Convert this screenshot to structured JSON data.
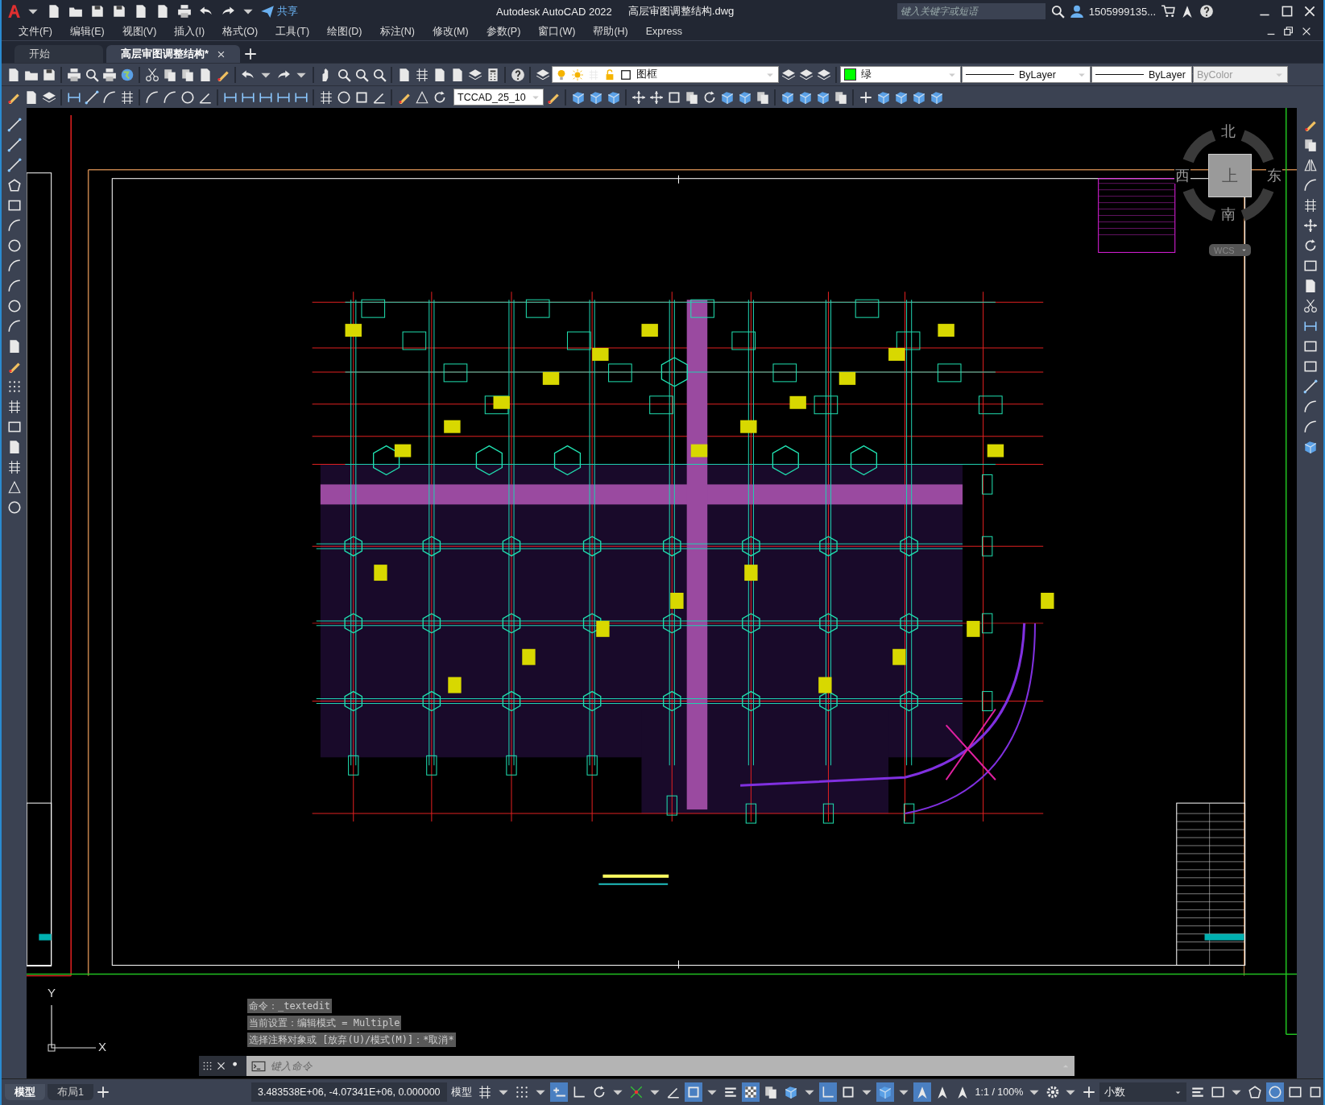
{
  "title_bar": {
    "share_label": "共享",
    "app_title": "Autodesk AutoCAD 2022",
    "file_name": "高层审图调整结构.dwg",
    "search": {
      "placeholder": "键入关键字或短语"
    },
    "user": "1505999135..."
  },
  "menu": [
    "文件(F)",
    "编辑(E)",
    "视图(V)",
    "插入(I)",
    "格式(O)",
    "工具(T)",
    "绘图(D)",
    "标注(N)",
    "修改(M)",
    "参数(P)",
    "窗口(W)",
    "帮助(H)",
    "Express"
  ],
  "file_tabs": [
    {
      "label": "开始",
      "selected": false
    },
    {
      "label": "高层审图调整结构*",
      "selected": true
    }
  ],
  "layer": {
    "name": "图框"
  },
  "properties": [
    {
      "kind": "color",
      "value": "绿",
      "color": "#00ff00",
      "disabled": false
    },
    {
      "kind": "linetype",
      "value": "ByLayer",
      "disabled": false
    },
    {
      "kind": "lineweight",
      "value": "ByLayer",
      "disabled": false
    },
    {
      "kind": "plotstyle",
      "value": "ByColor",
      "disabled": true
    }
  ],
  "dim_style": "TCCAD_25_10",
  "viewcube": {
    "north": "北",
    "south": "南",
    "west": "西",
    "east": "东",
    "face": "上",
    "ucs_menu": "WCS"
  },
  "ucs_icon": {
    "x": "X",
    "y": "Y"
  },
  "command": {
    "history": [
      "命令：_textedit",
      "当前设置：编辑模式 = Multiple",
      "选择注释对象或 [放弃(U)/模式(M)]：*取消*"
    ],
    "placeholder": "键入命令"
  },
  "layout_tabs": [
    {
      "label": "模型",
      "selected": true
    },
    {
      "label": "布局1",
      "selected": false
    }
  ],
  "status_bar": {
    "coordinates": "3.483538E+06, -4.07341E+06, 0.000000",
    "space": "模型",
    "toggles": [
      {
        "kind": "grid",
        "on": false
      },
      {
        "kind": "snap",
        "on": false
      },
      {
        "kind": "infer",
        "on": true
      },
      {
        "kind": "ortho",
        "on": false
      },
      {
        "kind": "polar",
        "on": false
      },
      {
        "kind": "otrack",
        "on": false
      },
      {
        "kind": "isodraft",
        "on": false
      },
      {
        "kind": "osnap",
        "on": true
      },
      {
        "kind": "lineweight",
        "on": false
      },
      {
        "kind": "transparency",
        "on": true
      },
      {
        "kind": "cycling",
        "on": false
      },
      {
        "kind": "osnap3d",
        "on": false
      },
      {
        "kind": "ducs",
        "on": true
      },
      {
        "kind": "filter",
        "on": false
      },
      {
        "kind": "gizmo",
        "on": true
      },
      {
        "kind": "annovis",
        "on": true
      },
      {
        "kind": "autoscale",
        "on": false
      },
      {
        "kind": "annoscale",
        "on": false
      }
    ],
    "annotation_scale": "1:1 / 100%",
    "units": "小数",
    "tail_toggles": [
      {
        "kind": "quickprops",
        "on": false
      },
      {
        "kind": "lockui",
        "on": false
      },
      {
        "kind": "isolate",
        "on": false
      },
      {
        "kind": "hwaccel",
        "on": true
      },
      {
        "kind": "cleanscreen",
        "on": false
      }
    ]
  }
}
